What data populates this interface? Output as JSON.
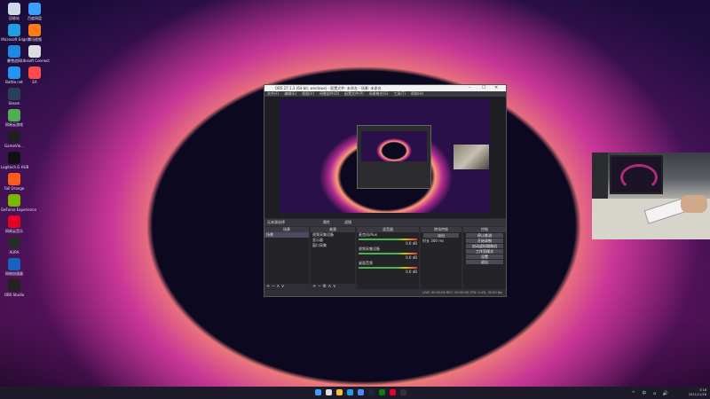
{
  "desktop": {
    "icons": [
      {
        "label": "回收站",
        "color": "#cfd8e6",
        "col": 0,
        "row": 0
      },
      {
        "label": "百度网盘",
        "color": "#3aa0ff",
        "col": 1,
        "row": 0
      },
      {
        "label": "Microsoft Edge",
        "color": "#1fa0e0",
        "col": 0,
        "row": 1
      },
      {
        "label": "腾讯视频",
        "color": "#ff7a1a",
        "col": 1,
        "row": 1
      },
      {
        "label": "暴雪战网",
        "color": "#1e88e5",
        "col": 0,
        "row": 2
      },
      {
        "label": "Ubisoft Connect",
        "color": "#dddddd",
        "col": 1,
        "row": 2
      },
      {
        "label": "Battle.net",
        "color": "#2196f3",
        "col": 0,
        "row": 3
      },
      {
        "label": "EA",
        "color": "#ff4b4b",
        "col": 1,
        "row": 3
      },
      {
        "label": "Steam",
        "color": "#2a3f5a",
        "col": 0,
        "row": 4
      },
      {
        "label": "网易云游戏",
        "color": "#4caf50",
        "col": 0,
        "row": 5
      },
      {
        "label": "GameVie...",
        "color": "#202020",
        "col": 0,
        "row": 6
      },
      {
        "label": "Logitech G HUB",
        "color": "#101010",
        "col": 0,
        "row": 7
      },
      {
        "label": "Fall Orange",
        "color": "#ff5a1a",
        "col": 0,
        "row": 8
      },
      {
        "label": "GeForce Experience",
        "color": "#76b900",
        "col": 0,
        "row": 9
      },
      {
        "label": "网易云音乐",
        "color": "#e60026",
        "col": 0,
        "row": 10
      },
      {
        "label": "AURA",
        "color": "#2b2b2b",
        "col": 0,
        "row": 11
      },
      {
        "label": "网络加速器",
        "color": "#1565c0",
        "col": 0,
        "row": 12
      },
      {
        "label": "OBS Studio",
        "color": "#222222",
        "col": 0,
        "row": 13
      }
    ]
  },
  "obs": {
    "title": "OBS 27.1.3 (64-bit, windows) - 配置文件: 未命名 - 场景: 未命名",
    "menu": [
      "文件(F)",
      "编辑(E)",
      "视图(V)",
      "停靠部件(D)",
      "配置文件(P)",
      "场景集合(S)",
      "工具(T)",
      "帮助(H)"
    ],
    "toolbar_text": "无来源选择",
    "toolbar_buttons": [
      "属性",
      "滤镜"
    ],
    "docks": {
      "scenes": {
        "header": "场景",
        "items": [
          "场景"
        ]
      },
      "sources": {
        "header": "来源",
        "items": [
          "视频采集设备",
          "显示器",
          "窗口采集"
        ]
      },
      "mixer": {
        "header": "混音器",
        "channels": [
          {
            "name": "麦克风/Aux",
            "db": "0.0 dB"
          },
          {
            "name": "视频采集设备",
            "db": "0.0 dB"
          },
          {
            "name": "桌面音频",
            "db": "0.0 dB"
          }
        ]
      },
      "transitions": {
        "header": "转场特效",
        "type": "淡出",
        "duration_label": "时长",
        "duration": "300 ms"
      },
      "controls": {
        "header": "控制",
        "buttons": [
          "停止推流",
          "开始录制",
          "启动虚拟摄像机",
          "工作室模式",
          "设置",
          "退出"
        ]
      }
    },
    "status": "LIVE: 00:00:00   REC: 00:00:00   CPU: 0.4%, 30.00 fps"
  },
  "taskbar": {
    "apps": [
      "windows-start",
      "search",
      "file-explorer",
      "edge",
      "store",
      "steam",
      "xbox",
      "netease-music",
      "obs"
    ],
    "tray_icons": "^ 中 ⌂ 🔊",
    "time": "3:18",
    "date": "2021/11/16"
  }
}
